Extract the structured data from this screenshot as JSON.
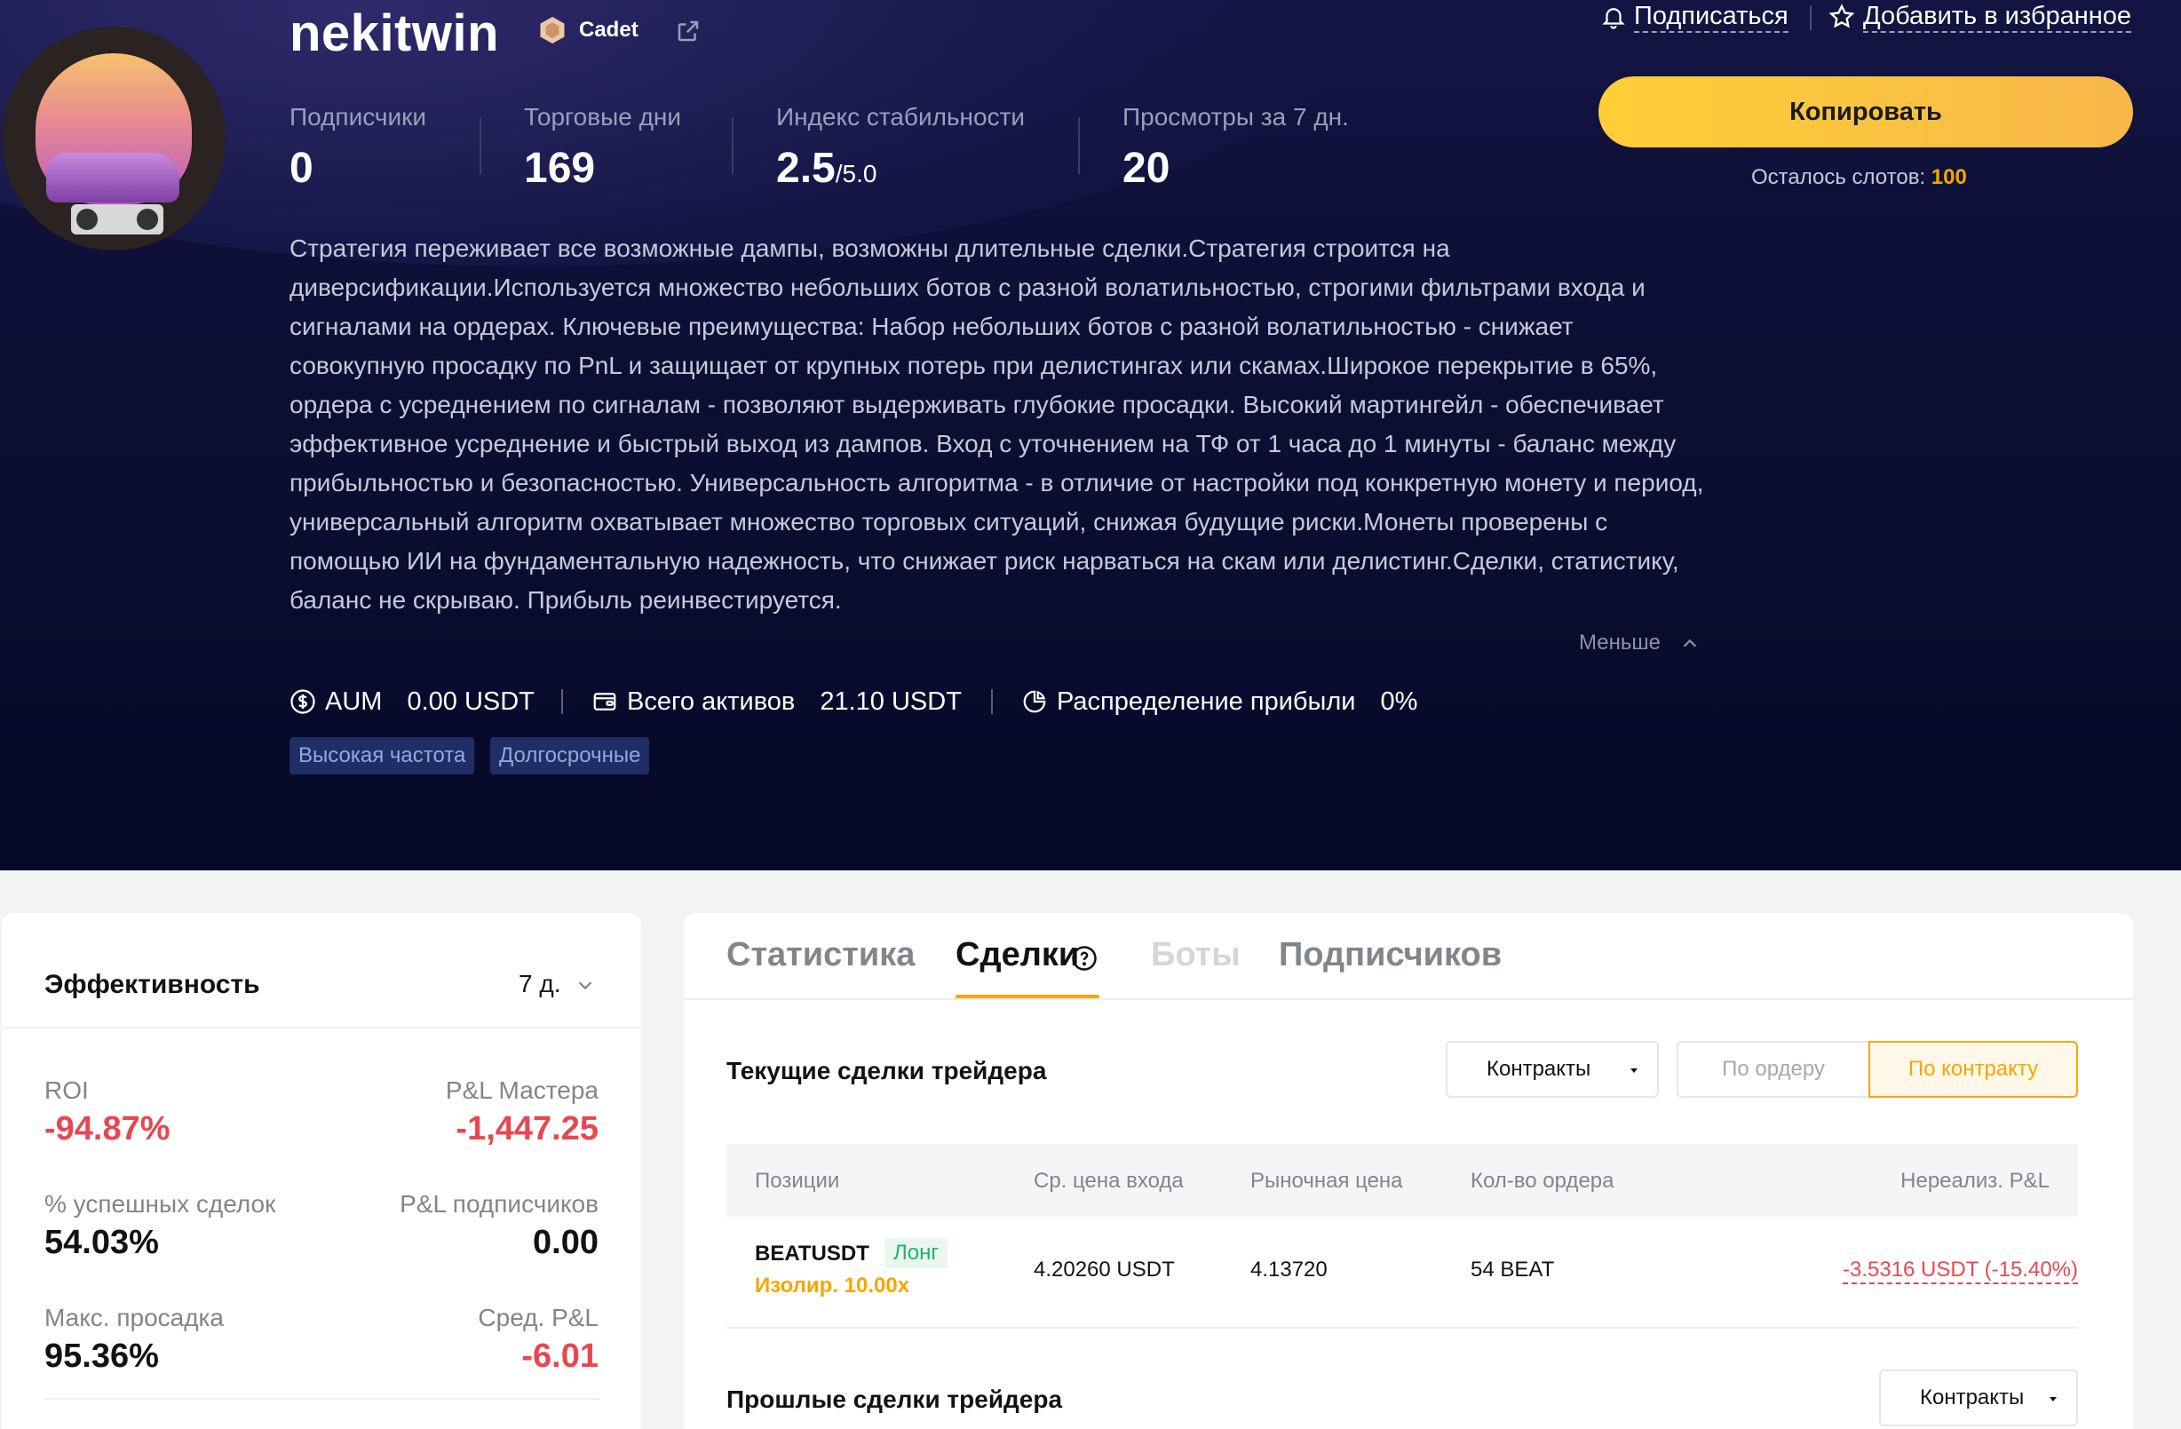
{
  "profile": {
    "nickname": "nekitwin",
    "rank": "Cadet",
    "stats": [
      {
        "label": "Подписчики",
        "value": "0"
      },
      {
        "label": "Торговые дни",
        "value": "169"
      },
      {
        "label": "Индекс стабильности",
        "value": "2.5",
        "suffix": "/5.0"
      },
      {
        "label": "Просмотры за 7 дн.",
        "value": "20"
      }
    ],
    "description": "Стратегия переживает все возможные дампы, возможны длительные сделки.Стратегия строится на диверсификации.Используется множество небольших ботов с разной волатильностью, строгими фильтрами входа и сигналами на ордерах. Ключевые преимущества: Набор небольших ботов с разной волатильностью - снижает совокупную просадку по PnL и защищает от крупных потерь при делистингах или скамах.Широкое перекрытие в 65%, ордера с усреднением по сигналам - позволяют выдерживать глубокие просадки. Высокий мартингейл - обеспечивает эффективное усреднение и быстрый выход из дампов. Вход с уточнением на ТФ от 1 часа до 1 минуты - баланс между прибыльностью и безопасностью. Универсальность алгоритма - в отличие от настройки под конкретную монету и период, универсальный алгоритм охватывает множество торговых ситуаций, снижая будущие риски.Монеты проверены с помощью ИИ на фундаментальную надежность, что снижает риск нарваться на скам или делистинг.Сделки, статистику, баланс не скрываю. Прибыль реинвестируется.",
    "less_label": "Меньше",
    "aum_label": "AUM",
    "aum_value": "0.00 USDT",
    "assets_label": "Всего активов",
    "assets_value": "21.10 USDT",
    "profit_share_label": "Распределение прибыли",
    "profit_share_value": "0%",
    "tags": [
      "Высокая частота",
      "Долгосрочные"
    ]
  },
  "actions": {
    "subscribe": "Подписаться",
    "favorite": "Добавить в избранное",
    "copy": "Копировать",
    "slots_label": "Осталось слотов:",
    "slots_value": "100"
  },
  "performance": {
    "title": "Эффективность",
    "period": "7 д.",
    "metrics": [
      {
        "label": "ROI",
        "value": "-94.87%"
      },
      {
        "label": "P&L Мастера",
        "value": "-1,447.25"
      },
      {
        "label": "% успешных сделок",
        "value": "54.03%"
      },
      {
        "label": "P&L подписчиков",
        "value": "0.00"
      },
      {
        "label": "Макс. просадка",
        "value": "95.36%"
      },
      {
        "label": "Сред. P&L",
        "value": "-6.01"
      }
    ]
  },
  "tabs": [
    "Статистика",
    "Сделки",
    "Боты",
    "Подписчиков"
  ],
  "current_trades": {
    "title": "Текущие сделки трейдера",
    "dropdown": "Контракты",
    "toggle_off": "По ордеру",
    "toggle_on": "По контракту",
    "columns": [
      "Позиции",
      "Ср. цена входа",
      "Рыночная цена",
      "Кол-во ордера",
      "Нереализ. P&L"
    ],
    "rows": [
      {
        "symbol": "BEATUSDT",
        "side": "Лонг",
        "margin": "Изолир. 10.00x",
        "entry": "4.20260 USDT",
        "market": "4.13720",
        "qty": "54 BEAT",
        "pnl": "-3.5316 USDT (-15.40%)"
      }
    ]
  },
  "past_trades": {
    "title": "Прошлые сделки трейдера",
    "dropdown": "Контракты"
  },
  "colors": {
    "accent": "#f7a600",
    "negative": "#e8474f",
    "positive": "#20b26c",
    "hero_bg": "#0c0e33"
  }
}
